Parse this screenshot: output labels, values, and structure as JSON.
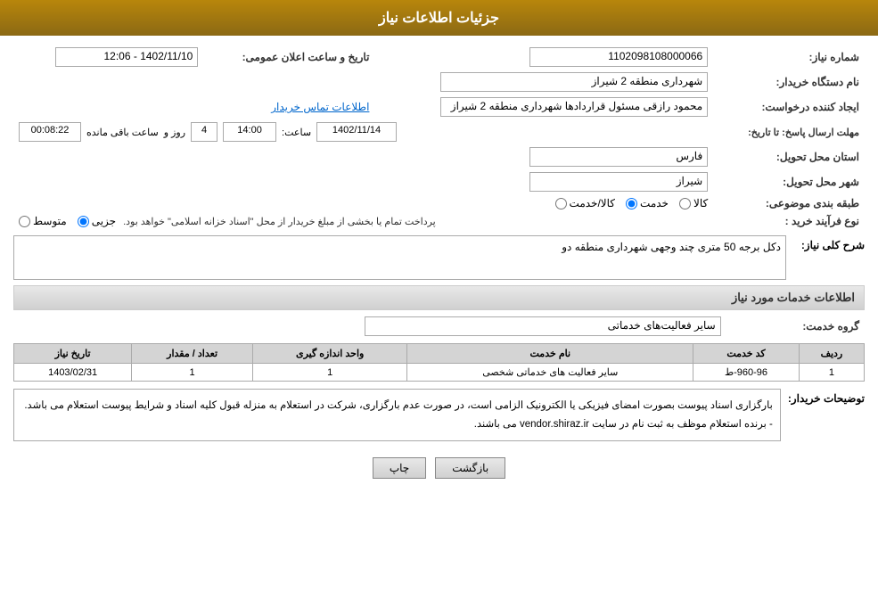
{
  "header": {
    "title": "جزئیات اطلاعات نیاز"
  },
  "fields": {
    "request_number_label": "شماره نیاز:",
    "request_number_value": "1102098108000066",
    "buyer_org_label": "نام دستگاه خریدار:",
    "buyer_org_value": "شهرداری منطقه 2 شیراز",
    "creator_label": "ایجاد کننده درخواست:",
    "creator_value": "محمود رازقی مسئول قراردادها شهرداری منطقه 2 شیراز",
    "contact_link": "اطلاعات تماس خریدار",
    "announce_date_label": "تاریخ و ساعت اعلان عمومی:",
    "announce_date_value": "1402/11/10 - 12:06",
    "send_deadline_label": "مهلت ارسال پاسخ: تا تاریخ:",
    "send_deadline_date": "1402/11/14",
    "send_deadline_time_label": "ساعت:",
    "send_deadline_time": "14:00",
    "send_deadline_day_label": "روز و",
    "send_deadline_days": "4",
    "remaining_label": "ساعت باقی مانده",
    "remaining_value": "00:08:22",
    "province_label": "استان محل تحویل:",
    "province_value": "فارس",
    "city_label": "شهر محل تحویل:",
    "city_value": "شیراز",
    "category_label": "طبقه بندی موضوعی:",
    "category_options": [
      "کالا",
      "خدمت",
      "کالا/خدمت"
    ],
    "category_selected": "خدمت",
    "process_label": "نوع فرآیند خرید :",
    "process_options": [
      "جزیی",
      "متوسط"
    ],
    "process_note": "پرداخت تمام یا بخشی از مبلغ خریدار از محل \"اسناد خزانه اسلامی\" خواهد بود.",
    "description_label": "شرح کلی نیاز:",
    "description_value": "دکل برجه 50 متری چند وجهی شهرداری منطقه دو",
    "services_section_title": "اطلاعات خدمات مورد نیاز",
    "service_group_label": "گروه خدمت:",
    "service_group_value": "سایر فعالیت‌های خدماتی"
  },
  "table": {
    "headers": [
      "ردیف",
      "کد خدمت",
      "نام خدمت",
      "واحد اندازه گیری",
      "تعداد / مقدار",
      "تاریخ نیاز"
    ],
    "rows": [
      {
        "row": "1",
        "code": "960-96-ط",
        "name": "سایر فعالیت های خدماتی شخصی",
        "unit": "1",
        "quantity": "1",
        "date": "1403/02/31"
      }
    ]
  },
  "buyer_notes_label": "توضیحات خریدار:",
  "buyer_notes": [
    "بارگزاری اسناد پیوست بصورت امضای فیزیکی یا الکترونیک الزامی است، در صورت عدم بارگزاری، شرکت در استعلام به منزله قبول کلیه اسناد و شرایط پیوست استعلام می باشد.",
    "- برنده استعلام موظف به ثبت نام در سایت vendor.shiraz.ir می باشند."
  ],
  "buttons": {
    "print": "چاپ",
    "back": "بازگشت"
  }
}
